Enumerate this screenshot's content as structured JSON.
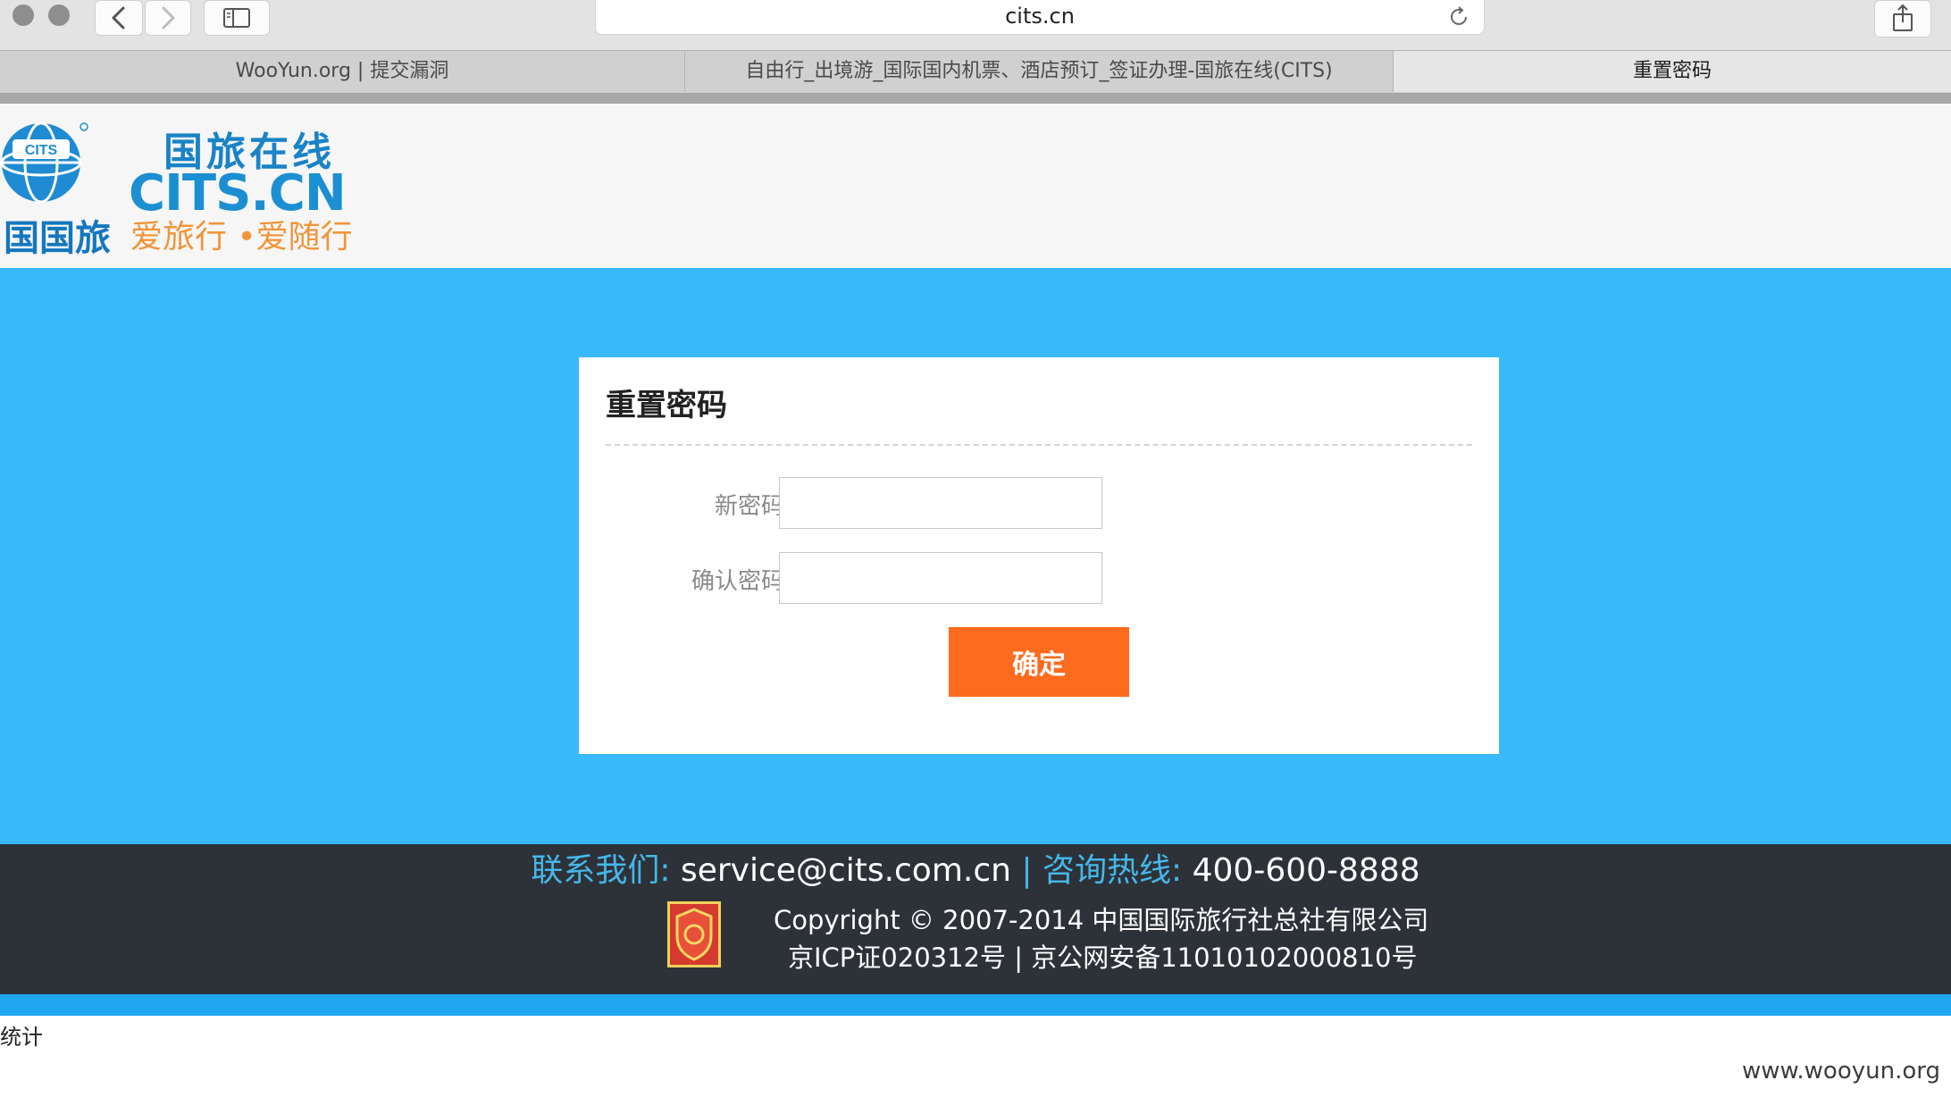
{
  "browser": {
    "url": "cits.cn",
    "tabs": [
      {
        "label": "WooYun.org | 提交漏洞",
        "active": false
      },
      {
        "label": "自由行_出境游_国际国内机票、酒店预订_签证办理-国旅在线(CITS)",
        "active": false
      },
      {
        "label": "重置密码",
        "active": true
      }
    ]
  },
  "header": {
    "logo_cn": "国旅在线",
    "logo_en": "CITS.CN",
    "logo_left": "国国旅",
    "logo_slogan": "爱旅行 •爱随行"
  },
  "form": {
    "title": "重置密码",
    "new_password_label": "新密码",
    "new_password_value": "",
    "confirm_password_label": "确认密码",
    "confirm_password_value": "",
    "submit_label": "确定"
  },
  "footer": {
    "contact_label": "联系我们:",
    "contact_email": "service@cits.com.cn",
    "separator": "|",
    "hotline_label": "咨询热线:",
    "hotline_number": "400-600-8888",
    "copyright": "Copyright © 2007-2014 中国国际旅行社总社有限公司",
    "icp": "京ICP证020312号 | 京公网安备11010102000810号"
  },
  "stats_text": "统计",
  "watermark": "www.wooyun.org",
  "colors": {
    "main_bg": "#38b9f9",
    "submit_button": "#fd6b1e",
    "footer_bg": "#2d3238",
    "footer_label": "#45b7ea",
    "logo_blue": "#1c8fd2",
    "logo_orange": "#f0953a"
  }
}
